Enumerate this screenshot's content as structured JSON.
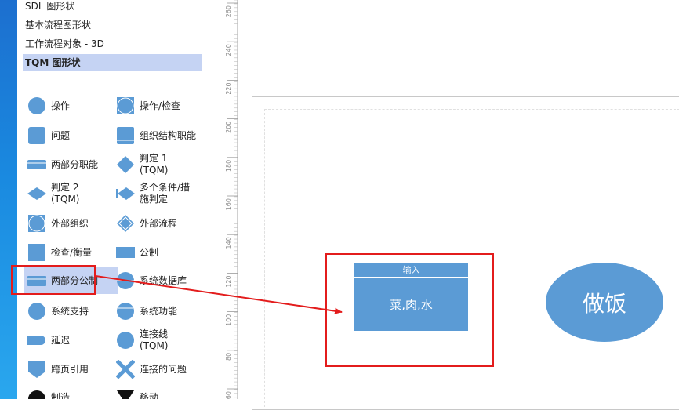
{
  "stencils": [
    {
      "label": "SDL 图形状",
      "selected": false
    },
    {
      "label": "基本流程图形状",
      "selected": false
    },
    {
      "label": "工作流程对象 - 3D",
      "selected": false
    },
    {
      "label": "TQM 图形状",
      "selected": true
    }
  ],
  "shapes": {
    "operation": "操作",
    "operation_inspect": "操作/检查",
    "problem": "问题",
    "org_function": "组织结构职能",
    "two_part_function": "两部分职能",
    "decision_1": "判定 1\n(TQM)",
    "decision_2": "判定 2\n(TQM)",
    "multi_condition": "多个条件/措\n施判定",
    "external_org": "外部组织",
    "external_process": "外部流程",
    "inspect_measure": "检查/衡量",
    "standard": "公制",
    "two_part_standard": "两部分公制",
    "system_database": "系统数据库",
    "system_support": "系统支持",
    "system_function": "系统功能",
    "delay": "延迟",
    "connector": "连接线\n(TQM)",
    "offpage_reference": "跨页引用",
    "connection_problem": "连接的问题",
    "manufacture": "制造",
    "move": "移动"
  },
  "ruler_ticks": [
    "260",
    "240",
    "220",
    "200",
    "180",
    "160",
    "140",
    "120",
    "100",
    "80",
    "60"
  ],
  "canvas": {
    "input_header": "输入",
    "input_body": "菜,肉,水",
    "ellipse_text": "做饭"
  },
  "colors": {
    "shape_fill": "#5b9bd5",
    "selection": "#c5d3f3",
    "highlight": "#e31c1c"
  }
}
